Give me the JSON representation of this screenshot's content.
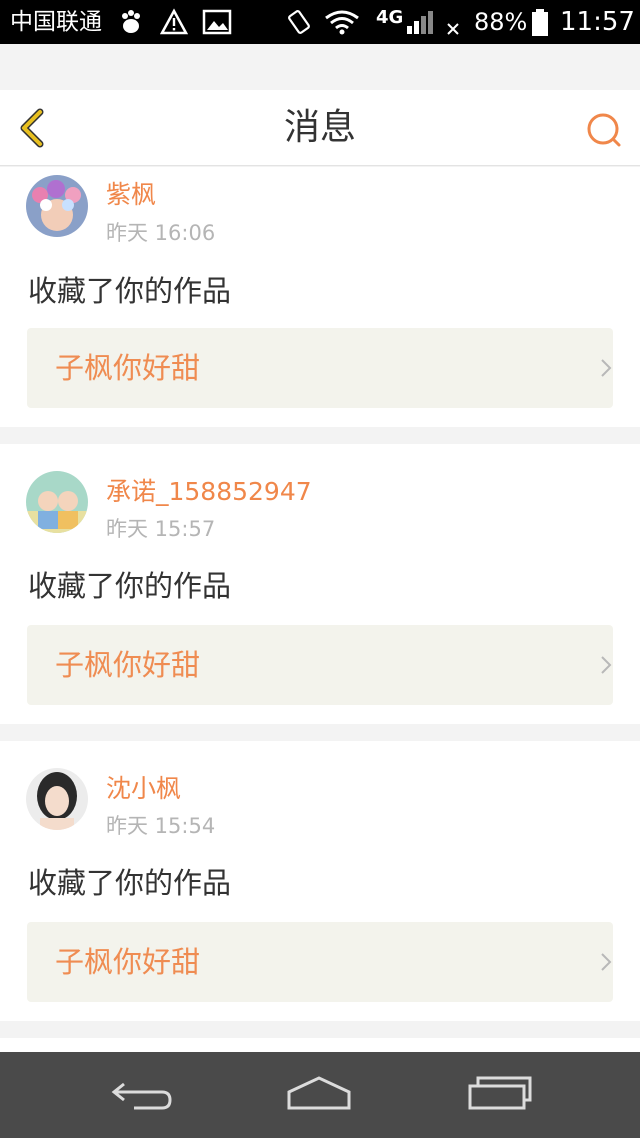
{
  "status_bar": {
    "carrier": "中国联通",
    "network": "4G",
    "battery": "88%",
    "time": "11:57"
  },
  "header": {
    "title": "消息",
    "back_icon": "chevron-left-icon",
    "search_icon": "search-icon"
  },
  "messages": [
    {
      "username": "紫枫",
      "time": "昨天 16:06",
      "action": "收藏了你的作品",
      "work_title": "子枫你好甜"
    },
    {
      "username": "承诺_158852947",
      "time": "昨天 15:57",
      "action": "收藏了你的作品",
      "work_title": "子枫你好甜"
    },
    {
      "username": "沈小枫",
      "time": "昨天 15:54",
      "action": "收藏了你的作品",
      "work_title": "子枫你好甜"
    }
  ],
  "colors": {
    "accent": "#f0874a",
    "back_icon": "#e8c020",
    "link_bg": "#f3f3ec"
  },
  "nav_bar": {
    "back": "back-icon",
    "home": "home-icon",
    "recents": "recents-icon"
  }
}
